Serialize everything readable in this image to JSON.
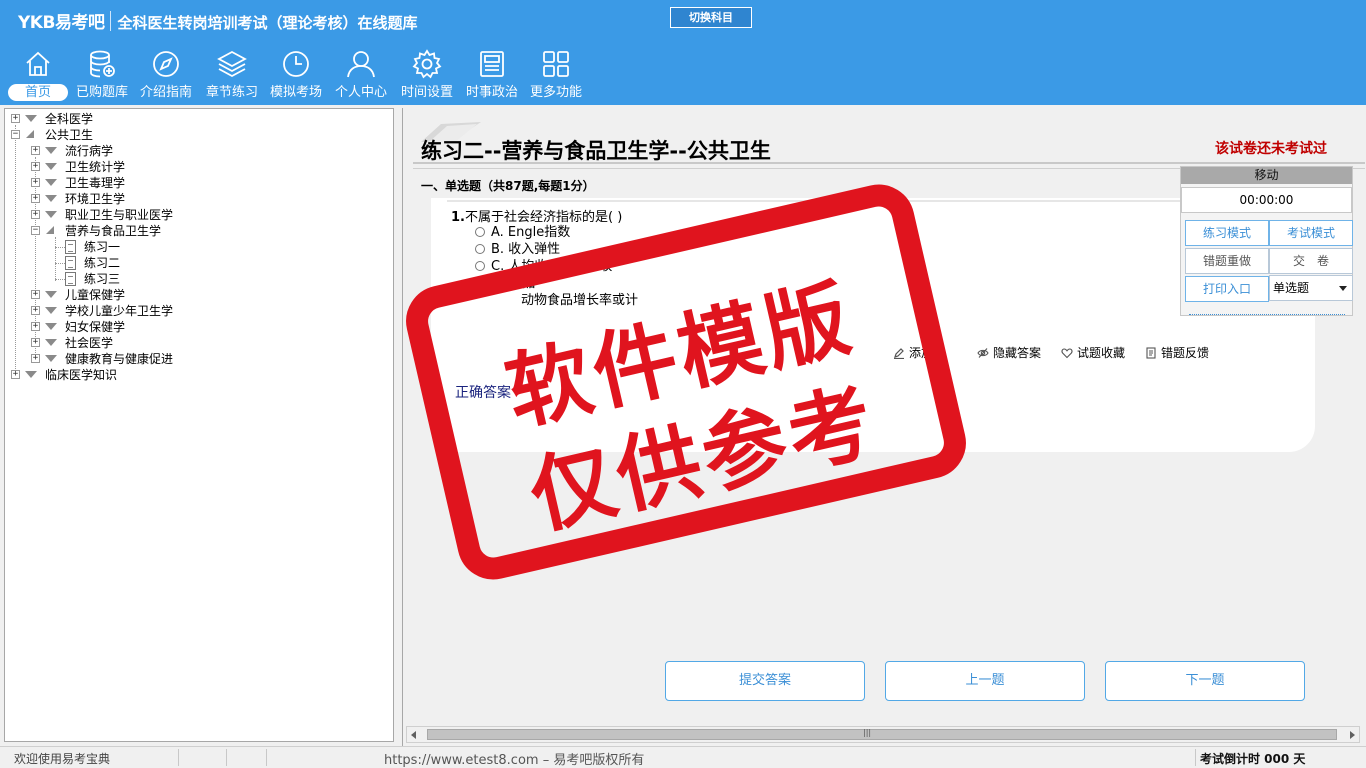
{
  "header": {
    "logo": "YKB易考吧",
    "title": "全科医生转岗培训考试（理论考核）在线题库",
    "switch_button": "切换科目"
  },
  "nav": [
    {
      "label": "首页",
      "icon": "home-icon"
    },
    {
      "label": "已购题库",
      "icon": "database-add-icon"
    },
    {
      "label": "介绍指南",
      "icon": "compass-icon"
    },
    {
      "label": "章节练习",
      "icon": "layers-icon"
    },
    {
      "label": "模拟考场",
      "icon": "clock-icon"
    },
    {
      "label": "个人中心",
      "icon": "user-icon"
    },
    {
      "label": "时间设置",
      "icon": "gear-icon"
    },
    {
      "label": "时事政治",
      "icon": "newspaper-icon"
    },
    {
      "label": "更多功能",
      "icon": "grid-icon"
    }
  ],
  "tree": {
    "n0": "全科医学",
    "n1": "公共卫生",
    "n2": "流行病学",
    "n3": "卫生统计学",
    "n4": "卫生毒理学",
    "n5": "环境卫生学",
    "n6": "职业卫生与职业医学",
    "n7": "营养与食品卫生学",
    "n8": "练习一",
    "n9": "练习二",
    "n10": "练习三",
    "n11": "儿童保健学",
    "n12": "学校儿童少年卫生学",
    "n13": "妇女保健学",
    "n14": "社会医学",
    "n15": "健康教育与健康促进",
    "n16": "临床医学知识"
  },
  "exam": {
    "title": "练习二--营养与食品卫生学--公共卫生",
    "status": "该试卷还未考试过",
    "section": "一、单选题（共87题,每题1分）",
    "question_number": "1.",
    "question_text": "不属于社会经济指标的是( )",
    "options": {
      "a": "A. Engle指数",
      "b": "B. 收入弹性",
      "c": "C. 人均收入及人均收",
      "d": "D. 食品",
      "e": "动物食品增长率或计"
    },
    "tools": {
      "add": "添加",
      "hide_answer": "隐藏答案",
      "favorite": "试题收藏",
      "feedback": "错题反馈"
    },
    "answer_label": "正确答案",
    "buttons": {
      "submit": "提交答案",
      "prev": "上一题",
      "next": "下一题"
    }
  },
  "panel": {
    "move": "移动",
    "timer": "00:00:00",
    "practice_mode": "练习模式",
    "exam_mode": "考试模式",
    "redo_wrong": "错题重做",
    "submit_paper": "交　卷",
    "print": "打印入口",
    "type_select": "单选题"
  },
  "stamp": {
    "line1": "软件模版",
    "line2": "仅供参考"
  },
  "statusbar": {
    "welcome": "欢迎使用易考宝典",
    "url": "https://www.etest8.com – 易考吧版权所有",
    "countdown": "考试倒计时 000 天"
  },
  "colors": {
    "header_blue": "#3b9ae6",
    "stamp_red": "#e0141e",
    "status_red": "#c00000"
  }
}
